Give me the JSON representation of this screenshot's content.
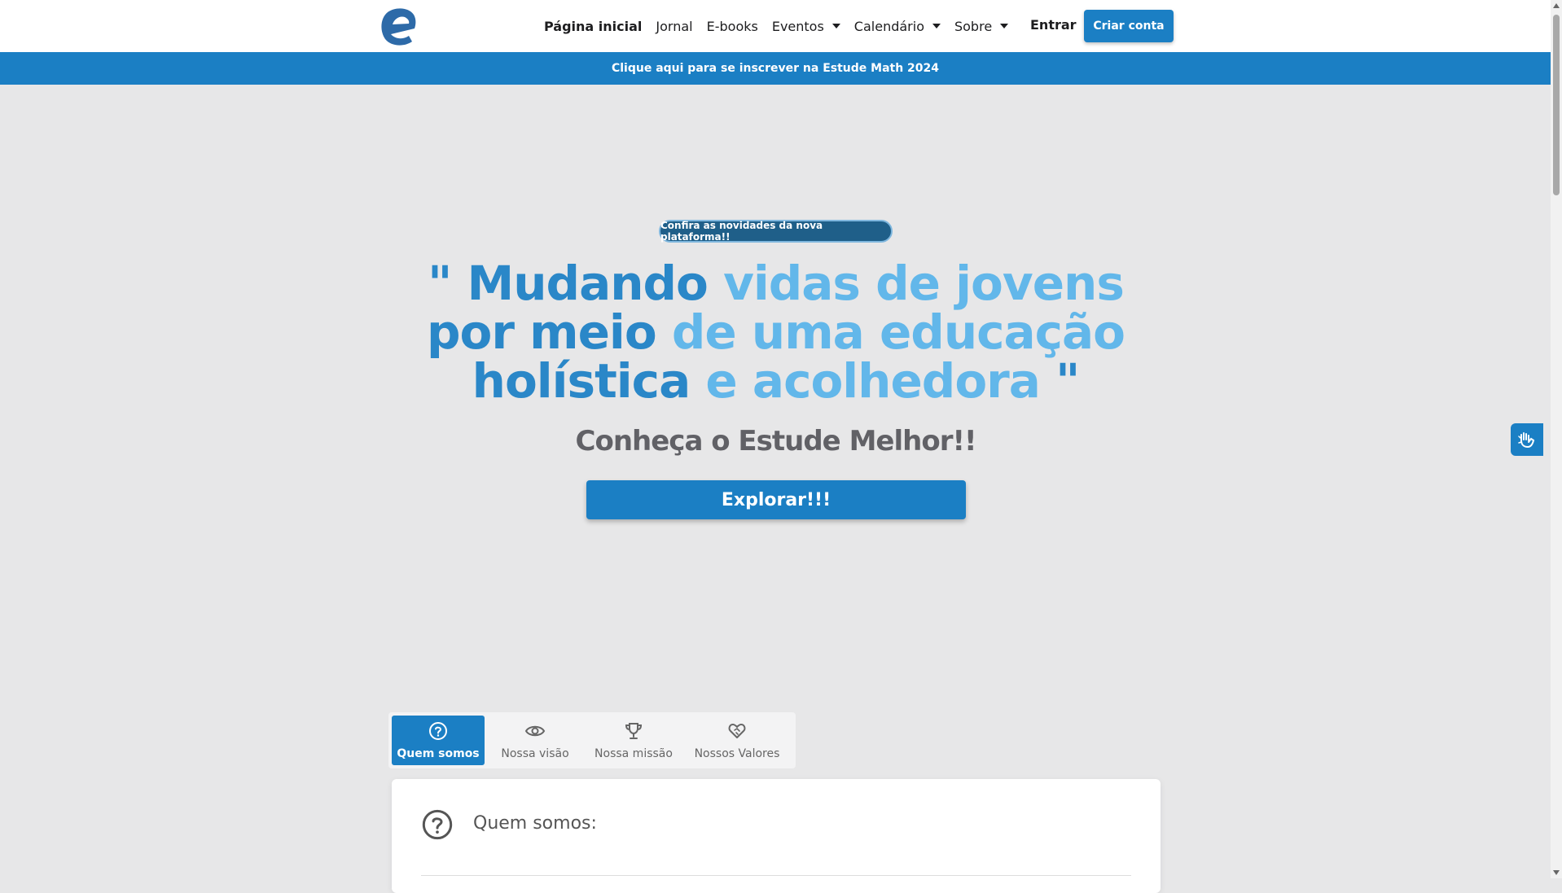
{
  "nav": {
    "items": [
      {
        "label": "Página inicial",
        "active": true,
        "dropdown": false
      },
      {
        "label": "Jornal",
        "active": false,
        "dropdown": false
      },
      {
        "label": "E-books",
        "active": false,
        "dropdown": false
      },
      {
        "label": "Eventos",
        "active": false,
        "dropdown": true
      },
      {
        "label": "Calendário",
        "active": false,
        "dropdown": true
      },
      {
        "label": "Sobre",
        "active": false,
        "dropdown": true
      }
    ],
    "login_label": "Entrar",
    "signup_label": "Criar conta"
  },
  "promo_banner": "Clique aqui para se inscrever na Estude Math 2024",
  "hero": {
    "badge": "Confira as novidades da nova plataforma!!",
    "headline_parts": [
      {
        "text": "\" Mudando ",
        "tone": "dark"
      },
      {
        "text": "vidas de jovens",
        "tone": "light"
      },
      {
        "text": " por meio ",
        "tone": "dark"
      },
      {
        "text": "de uma educação",
        "tone": "light"
      },
      {
        "text": " holística ",
        "tone": "dark"
      },
      {
        "text": "e acolhedora",
        "tone": "light"
      },
      {
        "text": " \"",
        "tone": "dark"
      }
    ],
    "subheadline": "Conheça o Estude Melhor!!",
    "cta_label": "Explorar!!!"
  },
  "tabs": [
    {
      "label": "Quem somos",
      "icon": "question-circle-icon",
      "active": true
    },
    {
      "label": "Nossa visão",
      "icon": "eye-icon",
      "active": false
    },
    {
      "label": "Nossa missão",
      "icon": "trophy-icon",
      "active": false
    },
    {
      "label": "Nossos Valores",
      "icon": "heart-handshake-icon",
      "active": false
    }
  ],
  "card": {
    "title": "Quem somos:",
    "icon": "question-circle-icon"
  },
  "colors": {
    "primary": "#1b7fc4",
    "headline_dark": "#2a87c8",
    "headline_light": "#62b7ea",
    "badge": "#1f5f89",
    "background": "#e7e7e8"
  }
}
